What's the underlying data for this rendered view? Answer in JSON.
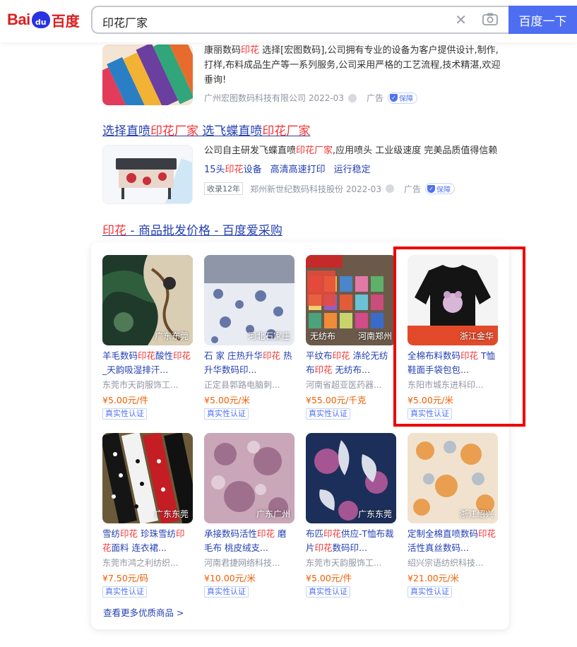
{
  "header": {
    "logo": {
      "bai": "Bai",
      "du": "du",
      "text": "百度"
    },
    "query": "印花厂家",
    "search_button": "百度一下"
  },
  "ad1": {
    "desc_pre": "康丽数码",
    "desc_red": "印花",
    "desc_post": " 选择[宏图数码],公司拥有专业的设备为客户提供设计,制作,打样,布料成品生产等一系列服务,公司采用严格的工艺流程,技术精湛,欢迎垂询!",
    "source": "广州宏图数码科技有限公司 2022-03",
    "ad_label": "广告",
    "safe_label": "保障"
  },
  "ad2": {
    "title_a": "选择直喷",
    "title_b": "印花厂家",
    "title_c": " 选飞蝶直喷",
    "title_d": "印花厂家",
    "desc_pre": "公司自主研发飞蝶直喷",
    "desc_red": "印花厂家",
    "desc_post": ",应用喷头 工业级速度 完美品质值得信赖",
    "links": [
      "15头印花设备",
      "高清高速打印",
      "运行稳定"
    ],
    "years": "收录12年",
    "source": "郑州新世纪数码科技股份 2022-03",
    "ad_label": "广告",
    "safe_label": "保障"
  },
  "aicaigou": {
    "title_red": "印花",
    "title_rest": " - 商品批发价格 - 百度爱采购",
    "products": [
      {
        "name": "羊毛数码印花酸性印花_天韵吸湿排汗...",
        "seller": "东莞市天韵服饰工...",
        "price": "¥5.00元/件",
        "loc": "广东东莞",
        "cert": "真实性认证"
      },
      {
        "name": "石 家 庄热升华印花 热升华数码印...",
        "seller": "正定县郭路电脑刺...",
        "price": "¥5.00元/米",
        "loc": "河北石家庄",
        "cert": "真实性认证"
      },
      {
        "name": "平纹布印花 涤纶无纺布印花 无纺布...",
        "seller": "河南省超亚医药器...",
        "price": "¥55.00元/千克",
        "loc": "河南郑州",
        "loc2": "无纺布",
        "cert": "真实性认证"
      },
      {
        "name": "全棉布料数码印花 T恤鞋面手袋包包...",
        "seller": "东阳市城东进科印...",
        "price": "¥5.00元/米",
        "loc": "浙江金华",
        "cert": "真实性认证"
      },
      {
        "name": "雪纺印花 珍珠雪纺印花面料 连衣裙...",
        "seller": "东莞市鸿之利纺织...",
        "price": "¥7.50元/码",
        "loc": "广东东莞",
        "cert": "真实性认证"
      },
      {
        "name": "承接数码活性印花 磨毛布 桃皮绒支...",
        "seller": "河南君捷网络科技...",
        "price": "¥10.00元/米",
        "loc": "广东广州",
        "cert": "真实性认证"
      },
      {
        "name": "布匹印花供应-T恤布裁片印花数码印...",
        "seller": "东莞市天韵服饰工...",
        "price": "¥5.00元/件",
        "loc": "广东东莞",
        "cert": "真实性认证"
      },
      {
        "name": "定制全棉直喷数码印花 活性真丝数码...",
        "seller": "绍兴宗语纺织科技...",
        "price": "¥21.00元/米",
        "loc": "浙江绍兴",
        "cert": "真实性认证"
      }
    ],
    "more": "查看更多优质商品 >"
  }
}
